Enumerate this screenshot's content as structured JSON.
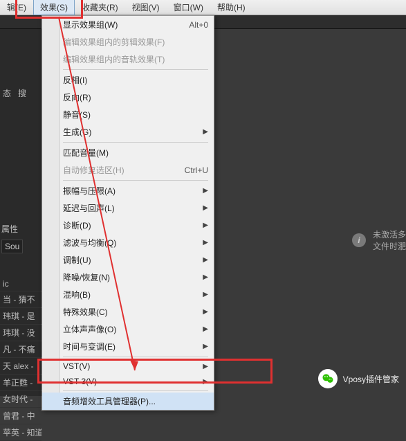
{
  "menubar": {
    "items": [
      {
        "label": "辑(E)"
      },
      {
        "label": "效果(S)"
      },
      {
        "label": "收藏夹(R)"
      },
      {
        "label": "视图(V)"
      },
      {
        "label": "窗口(W)"
      },
      {
        "label": "帮助(H)"
      }
    ],
    "active_index": 1
  },
  "dropdown": {
    "groups": [
      [
        {
          "label": "显示效果组(W)",
          "shortcut": "Alt+0"
        },
        {
          "label": "编辑效果组内的剪辑效果(F)",
          "disabled": true
        },
        {
          "label": "编辑效果组内的音轨效果(T)",
          "disabled": true
        }
      ],
      [
        {
          "label": "反相(I)"
        },
        {
          "label": "反向(R)"
        },
        {
          "label": "静音(S)"
        },
        {
          "label": "生成(G)",
          "submenu": true
        }
      ],
      [
        {
          "label": "匹配音量(M)"
        },
        {
          "label": "自动修复选区(H)",
          "shortcut": "Ctrl+U",
          "disabled": true
        }
      ],
      [
        {
          "label": "振幅与压限(A)",
          "submenu": true
        },
        {
          "label": "延迟与回声(L)",
          "submenu": true
        },
        {
          "label": "诊断(D)",
          "submenu": true
        },
        {
          "label": "滤波与均衡(Q)",
          "submenu": true
        },
        {
          "label": "调制(U)",
          "submenu": true
        },
        {
          "label": "降噪/恢复(N)",
          "submenu": true
        },
        {
          "label": "混响(B)",
          "submenu": true
        },
        {
          "label": "特殊效果(C)",
          "submenu": true
        },
        {
          "label": "立体声声像(O)",
          "submenu": true
        },
        {
          "label": "时间与变调(E)",
          "submenu": true
        }
      ],
      [
        {
          "label": "VST(V)",
          "submenu": true
        },
        {
          "label": "VST 3(V)",
          "submenu": true
        }
      ],
      [
        {
          "label": "音频增效工具管理器(P)...",
          "hover": true
        }
      ]
    ]
  },
  "left_panel": {
    "tab1": "态",
    "tab2": "搜",
    "prop_label": "属性",
    "prop_value": "Sou"
  },
  "filelist": [
    "ic",
    "当 - 猜不",
    "玮琪 - 是",
    "玮琪 - 没",
    "凡 - 不痛",
    "天 alex -",
    "羊正甦 -",
    "女时代 -",
    "曾君 - 中",
    "苹英 - 知道不知道  m"
  ],
  "notice": {
    "icon": "i",
    "line1": "未激活多",
    "line2": "文件时淝"
  },
  "wechat": {
    "label": "Vposy插件管家"
  }
}
